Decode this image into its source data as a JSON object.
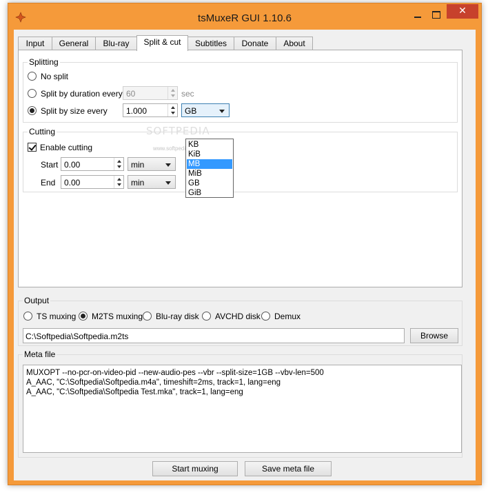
{
  "window": {
    "title": "tsMuxeR GUI 1.10.6",
    "close_glyph": "✕"
  },
  "tabs": [
    {
      "label": "Input"
    },
    {
      "label": "General"
    },
    {
      "label": "Blu-ray"
    },
    {
      "label": "Split & cut"
    },
    {
      "label": "Subtitles"
    },
    {
      "label": "Donate"
    },
    {
      "label": "About"
    }
  ],
  "active_tab": "Split & cut",
  "splitting": {
    "group_label": "Splitting",
    "no_split": "No split",
    "by_duration": "Split by duration every",
    "duration_value": "60",
    "duration_unit": "sec",
    "by_size": "Split by size every",
    "size_value": "1.000",
    "size_unit": "GB",
    "unit_options": [
      "KB",
      "KiB",
      "MB",
      "MiB",
      "GB",
      "GiB"
    ],
    "highlighted_option": "MB",
    "selected_mode": "by_size"
  },
  "watermark": {
    "main": "SOFTPEDIA",
    "sub": "www.softpedia.com"
  },
  "cutting": {
    "group_label": "Cutting",
    "enable_label": "Enable cutting",
    "enabled": true,
    "start_label": "Start",
    "start_value": "0.00",
    "start_unit": "min",
    "end_label": "End",
    "end_value": "0.00",
    "end_unit": "min"
  },
  "output": {
    "group_label": "Output",
    "modes": [
      "TS muxing",
      "M2TS muxing",
      "Blu-ray disk",
      "AVCHD disk",
      "Demux"
    ],
    "selected_mode": "M2TS muxing",
    "path": "C:\\Softpedia\\Softpedia.m2ts",
    "browse_label": "Browse"
  },
  "meta": {
    "group_label": "Meta file",
    "lines": [
      "MUXOPT --no-pcr-on-video-pid --new-audio-pes --vbr  --split-size=1GB --vbv-len=500",
      "A_AAC, \"C:\\Softpedia\\Softpedia.m4a\", timeshift=2ms, track=1, lang=eng",
      "A_AAC, \"C:\\Softpedia\\Softpedia Test.mka\", track=1, lang=eng"
    ]
  },
  "actions": {
    "start_label": "Start muxing",
    "save_label": "Save meta file"
  },
  "colors": {
    "frame": "#f59a3a",
    "close": "#c7412c",
    "selection": "#3399ff"
  }
}
